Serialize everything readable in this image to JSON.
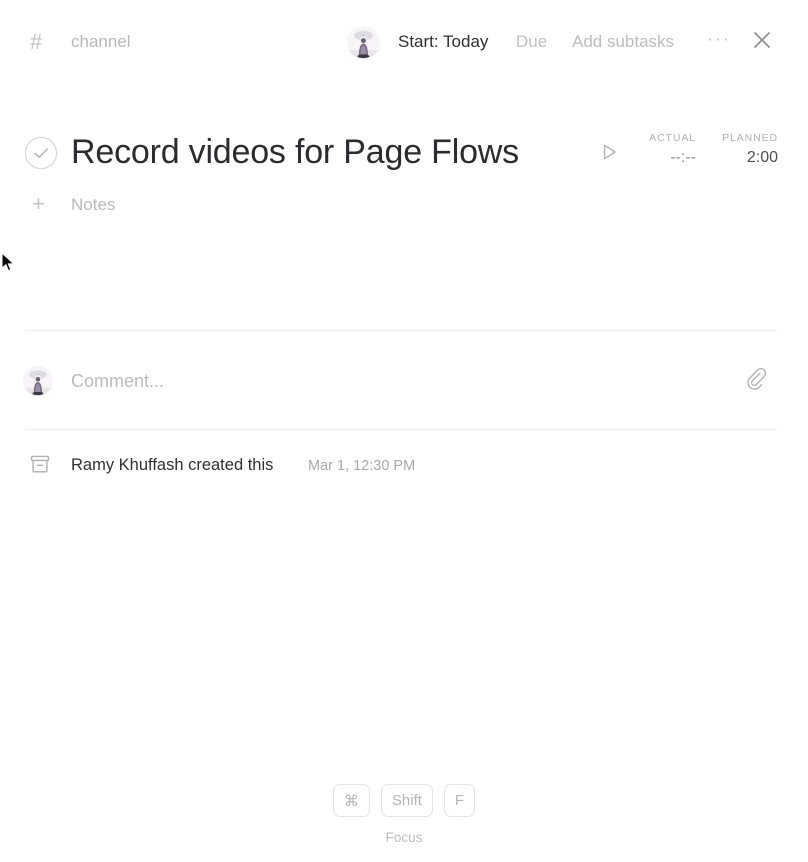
{
  "header": {
    "hash_icon": "hash-icon",
    "channel": "channel",
    "start_date": "Start: Today",
    "due": "Due",
    "add_subtasks": "Add subtasks",
    "more": "···",
    "close_icon": "close-icon",
    "avatar": "user-avatar"
  },
  "task": {
    "checkbox_icon": "check-circle-icon",
    "title": "Record videos for Page Flows",
    "play_icon": "play-icon",
    "timer": {
      "actual_label": "ACTUAL",
      "actual_value": "--:--",
      "planned_label": "PLANNED",
      "planned_value": "2:00"
    },
    "notes": {
      "plus_icon": "plus-icon",
      "placeholder": "Notes"
    }
  },
  "comment": {
    "avatar": "user-avatar",
    "placeholder": "Comment...",
    "attach_icon": "paperclip-icon"
  },
  "activity": {
    "icon": "archive-box-icon",
    "text": "Ramy Khuffash created this",
    "timestamp": "Mar 1, 12:30 PM"
  },
  "shortcut": {
    "keys": [
      "⌘",
      "Shift",
      "F"
    ],
    "caption": "Focus"
  },
  "colors": {
    "text_primary": "#2b2c2f",
    "text_muted": "#bcbcbf",
    "divider": "#f0f0f2",
    "background": "#ffffff"
  }
}
